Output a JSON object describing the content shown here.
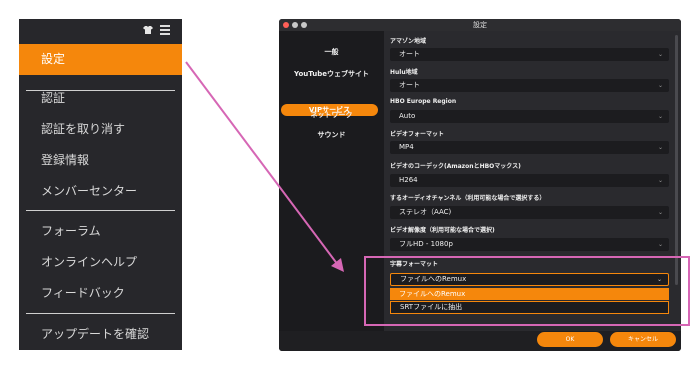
{
  "menu": {
    "active_label": "設定",
    "items": [
      "認証",
      "認証を取り消す",
      "登録情報",
      "メンバーセンター",
      "フォーラム",
      "オンラインヘルプ",
      "フィードバック",
      "アップデートを確認"
    ],
    "icons": [
      "shirt-icon",
      "hamburger-icon"
    ]
  },
  "window": {
    "title": "設定",
    "nav": {
      "items": [
        "一般",
        "YouTubeウェブサイト",
        "VIPサービス",
        "ネットワーク",
        "サウンド"
      ],
      "selected": "VIPサービス"
    },
    "settings": [
      {
        "label": "アマゾン地域",
        "value": "オート"
      },
      {
        "label": "Hulu地域",
        "value": "オート"
      },
      {
        "label": "HBO Europe Region",
        "value": "Auto"
      },
      {
        "label": "ビデオフォーマット",
        "value": "MP4"
      },
      {
        "label": "ビデオのコーデック(AmazonとHBOマックス)",
        "value": "H264"
      },
      {
        "label": "するオーディオチャンネル（利用可能な場合で選択する）",
        "value": "ステレオ（AAC)"
      },
      {
        "label": "ビデオ解像度（利用可能な場合で選択)",
        "value": "フルHD - 1080p"
      }
    ],
    "subtitle": {
      "label": "字幕フォーマット",
      "value": "ファイルへのRemux",
      "options": [
        "ファイルへのRemux",
        "SRTファイルに抽出"
      ]
    },
    "ok_label": "OK",
    "cancel_label": "キャンセル"
  },
  "colors": {
    "accent": "#f5870c",
    "highlight": "#d667b5",
    "window_bg": "#1f1f22",
    "menu_bg": "#27272b"
  }
}
